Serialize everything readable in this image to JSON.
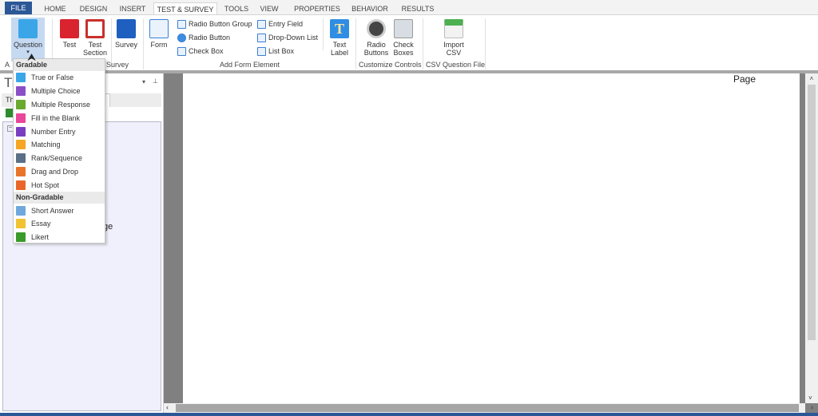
{
  "tabs": [
    "FILE",
    "HOME",
    "DESIGN",
    "INSERT",
    "TEST & SURVEY",
    "TOOLS",
    "VIEW",
    "PROPERTIES",
    "BEHAVIOR",
    "RESULTS"
  ],
  "active_tab": "TEST & SURVEY",
  "ribbon": {
    "question": "Question",
    "test": "Test",
    "test_section": "Test Section",
    "survey": "Survey",
    "form": "Form",
    "radio_button_group": "Radio Button Group",
    "radio_button": "Radio Button",
    "check_box": "Check Box",
    "entry_field": "Entry Field",
    "drop_down_list": "Drop-Down List",
    "list_box": "List Box",
    "text_label": "Text Label",
    "radio_buttons": "Radio Buttons",
    "check_boxes": "Check Boxes",
    "import_csv": "Import CSV",
    "groups": {
      "add_question": "A",
      "survey": "Survey",
      "add_form_element": "Add Form Element",
      "customize_controls": "Customize Controls",
      "csv_question_file": "CSV Question File"
    }
  },
  "panel": {
    "title": "Ti",
    "tab": "Th",
    "tree_item": "ge"
  },
  "menu": {
    "gradable_header": "Gradable",
    "gradable": [
      {
        "label": "True or False",
        "color": "#3aa6e8"
      },
      {
        "label": "Multiple Choice",
        "color": "#8a4fc7"
      },
      {
        "label": "Multiple Response",
        "color": "#6aa82e"
      },
      {
        "label": "Fill in the Blank",
        "color": "#e9479a"
      },
      {
        "label": "Number Entry",
        "color": "#7a3fc0"
      },
      {
        "label": "Matching",
        "color": "#f5a623"
      },
      {
        "label": "Rank/Sequence",
        "color": "#5b6f86"
      },
      {
        "label": "Drag and Drop",
        "color": "#e8742a"
      },
      {
        "label": "Hot Spot",
        "color": "#e8662a"
      }
    ],
    "nongradable_header": "Non-Gradable",
    "nongradable": [
      {
        "label": "Short Answer",
        "color": "#6fa8dc"
      },
      {
        "label": "Essay",
        "color": "#f1c232"
      },
      {
        "label": "Likert",
        "color": "#3a9a2a"
      }
    ]
  },
  "document": {
    "header_text": "Page"
  }
}
